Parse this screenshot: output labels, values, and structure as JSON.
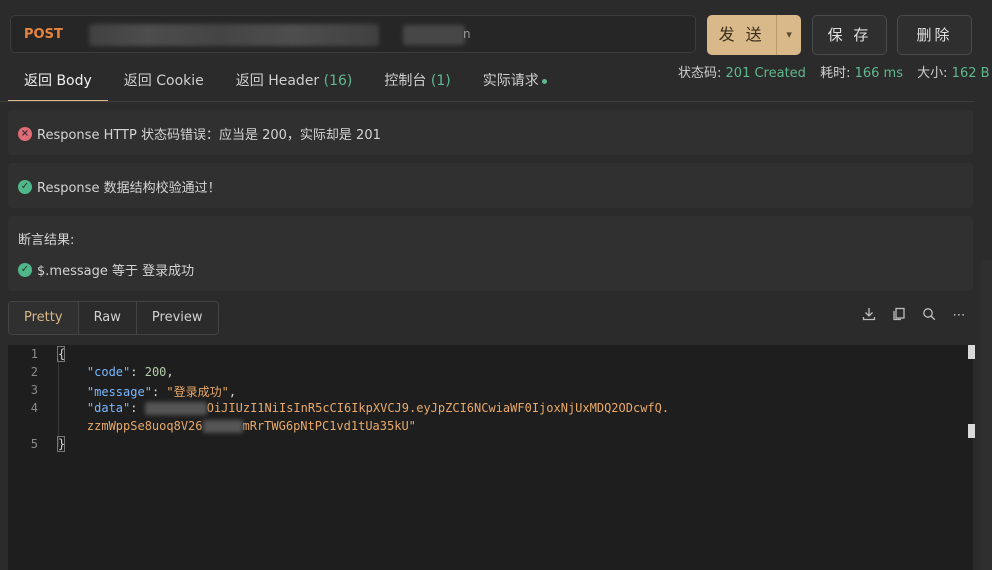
{
  "request": {
    "method": "POST",
    "url_tail": "n",
    "send_label": "发 送",
    "save_label": "保 存",
    "delete_label": "删除"
  },
  "tabs": [
    {
      "label": "返回 Body",
      "count": ""
    },
    {
      "label": "返回 Cookie",
      "count": ""
    },
    {
      "label": "返回 Header ",
      "count": "(16)"
    },
    {
      "label": "控制台 ",
      "count": "(1)"
    },
    {
      "label": "实际请求",
      "count": ""
    }
  ],
  "status": {
    "status_label": "状态码:",
    "status_value": "201 Created",
    "time_label": "耗时:",
    "time_value": "166 ms",
    "size_label": "大小:",
    "size_value": "162 B"
  },
  "checks": {
    "http_error": "Response HTTP 状态码错误：应当是 200，实际却是 201",
    "schema_ok": "Response 数据结构校验通过！",
    "assert_title": "断言结果:",
    "assert_item": "$.message 等于 登录成功"
  },
  "view_modes": [
    "Pretty",
    "Raw",
    "Preview"
  ],
  "toolbar_icons": [
    "download-icon",
    "copy-icon",
    "search-icon",
    "more-icon"
  ],
  "code": {
    "line_numbers": [
      "1",
      "2",
      "3",
      "4",
      "",
      "5"
    ],
    "open_brace": "{",
    "close_brace": "}",
    "code_key": "\"code\"",
    "code_value": "200",
    "message_key": "\"message\"",
    "message_value": "\"登录成功\"",
    "data_key": "\"data\"",
    "data_value_line1": "OiJIUzI1NiIsInR5cCI6IkpXVCJ9.eyJpZCI6NCwiaWF0IjoxNjUxMDQ2ODcwfQ.",
    "data_value_line2_a": "zzmWppSe8uoq8V26",
    "data_value_line2_b": "mRrTWG6pNtPC1vd1tUa35kU\""
  },
  "colors": {
    "accent": "#d9b98a",
    "success": "#5fb88e",
    "error": "#e06c75",
    "method": "#e8853d"
  }
}
